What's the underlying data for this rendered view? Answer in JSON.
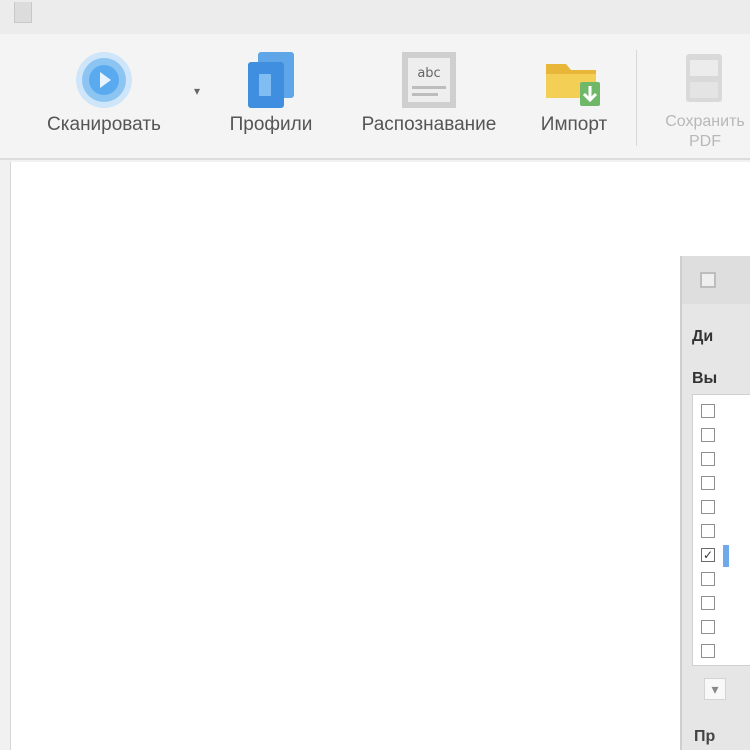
{
  "toolbar": {
    "scan_label": "Сканировать",
    "profiles_label": "Профили",
    "recognize_label": "Распознавание",
    "import_label": "Импорт",
    "save_label": "Сохранить\nPDF"
  },
  "panel": {
    "top_label": "Ди",
    "list_label": "Вы",
    "footer_label": "Пр",
    "items": [
      {
        "checked": false
      },
      {
        "checked": false
      },
      {
        "checked": false
      },
      {
        "checked": false
      },
      {
        "checked": false
      },
      {
        "checked": false
      },
      {
        "checked": true
      },
      {
        "checked": false
      },
      {
        "checked": false
      },
      {
        "checked": false
      },
      {
        "checked": false
      }
    ]
  },
  "colors": {
    "accent": "#4a9de8",
    "scan_icon": "#7fbdf1",
    "folder": "#f1c94a"
  },
  "icons": {
    "scan": "scan-disc-icon",
    "profiles": "profiles-pages-icon",
    "recognize": "ocr-abc-icon",
    "import": "folder-import-icon",
    "save": "save-pdf-icon"
  }
}
